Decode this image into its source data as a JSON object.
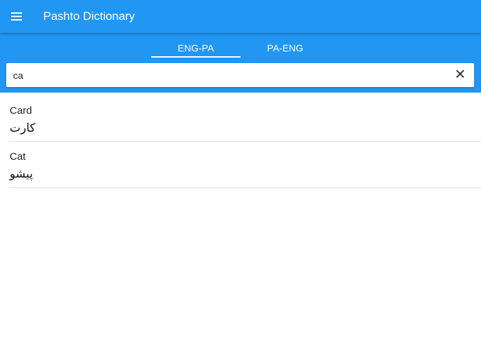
{
  "header": {
    "title": "Pashto Dictionary",
    "menu_icon": "hamburger-menu-icon"
  },
  "tabs": [
    {
      "label": "ENG-PA",
      "active": true
    },
    {
      "label": "PA-ENG",
      "active": false
    }
  ],
  "search": {
    "value": "ca",
    "clear_icon": "close-icon"
  },
  "results": [
    {
      "english": "Card",
      "pashto": "کارت"
    },
    {
      "english": "Cat",
      "pashto": "پیشو"
    }
  ]
}
